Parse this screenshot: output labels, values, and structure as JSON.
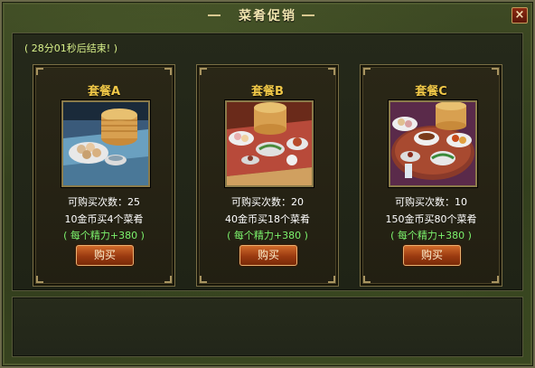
{
  "window": {
    "title": "菜肴促销",
    "close_label": "×"
  },
  "promo": {
    "timer_text": "( 28分01秒后结束! )"
  },
  "packages": [
    {
      "name": "套餐A",
      "purchases": "可购买次数：25",
      "offer": "10金币买4个菜肴",
      "bonus": "( 每个精力+380 )",
      "button": "购买"
    },
    {
      "name": "套餐B",
      "purchases": "可购买次数：20",
      "offer": "40金币买18个菜肴",
      "bonus": "( 每个精力+380 )",
      "button": "购买"
    },
    {
      "name": "套餐C",
      "purchases": "可购买次数：10",
      "offer": "150金币买80个菜肴",
      "bonus": "( 每个精力+380 )",
      "button": "购买"
    }
  ]
}
